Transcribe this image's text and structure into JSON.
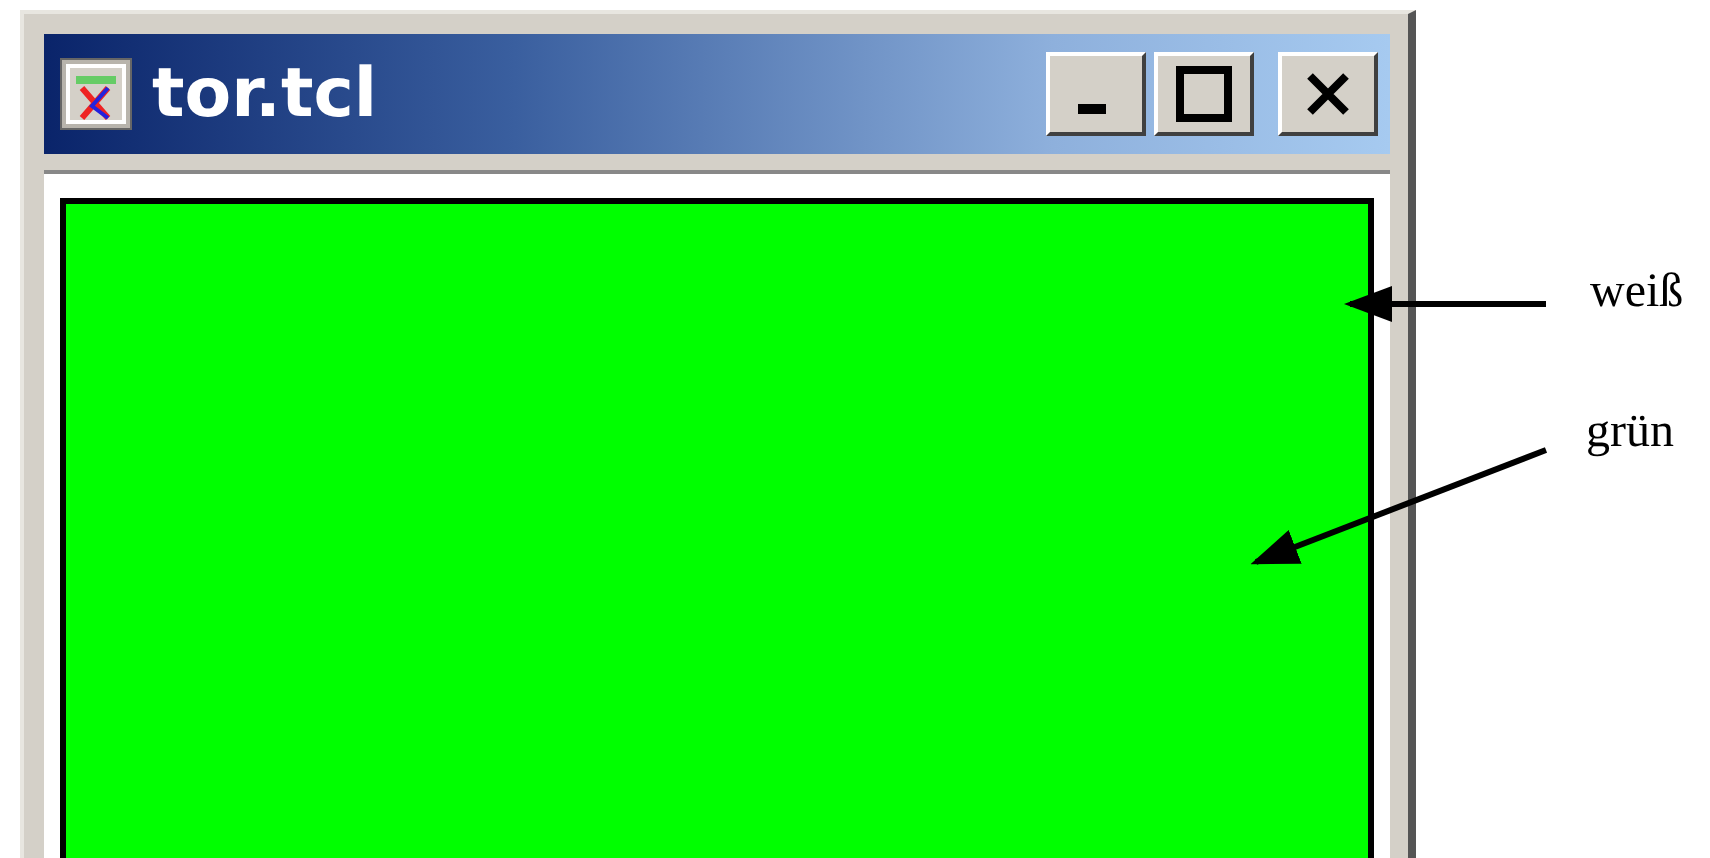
{
  "window": {
    "title": "tor.tcl"
  },
  "annotations": [
    {
      "label": "weiß",
      "kind": "frame"
    },
    {
      "label": "grün",
      "kind": "canvas"
    }
  ]
}
